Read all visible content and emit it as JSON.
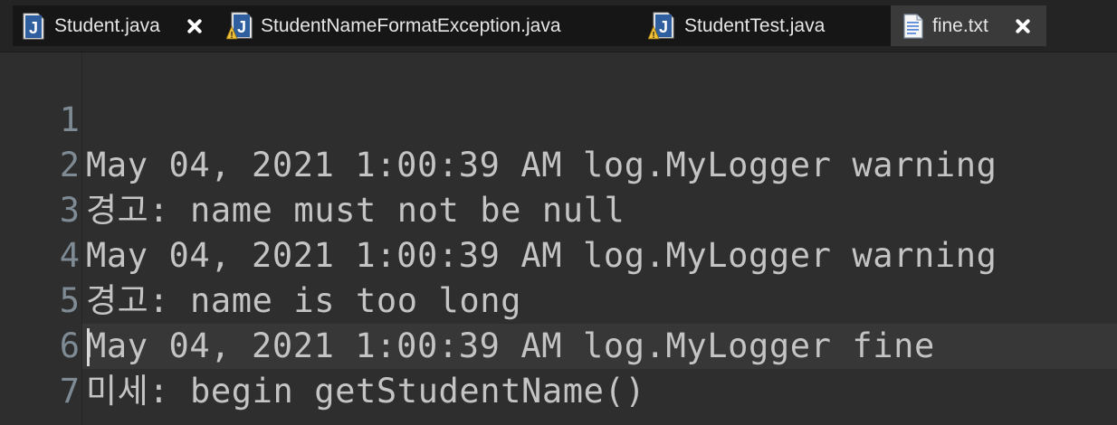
{
  "tabs": [
    {
      "label": "Student.java",
      "icon": "java-file-icon",
      "closable": true
    },
    {
      "label": "StudentNameFormatException.java",
      "icon": "java-file-warning-icon",
      "closable": false
    },
    {
      "label": "StudentTest.java",
      "icon": "java-file-warning-icon",
      "closable": false
    },
    {
      "label": "fine.txt",
      "icon": "text-file-icon",
      "closable": true
    }
  ],
  "editor": {
    "lines": [
      {
        "number": "1",
        "text": "May 04, 2021 1:00:39 AM log.MyLogger warning"
      },
      {
        "number": "2",
        "text": "경고: name must not be null"
      },
      {
        "number": "3",
        "text": "May 04, 2021 1:00:39 AM log.MyLogger warning"
      },
      {
        "number": "4",
        "text": "경고: name is too long"
      },
      {
        "number": "5",
        "text": "May 04, 2021 1:00:39 AM log.MyLogger fine"
      },
      {
        "number": "6",
        "text": "미세: begin getStudentName()"
      },
      {
        "number": "7",
        "text": ""
      }
    ]
  },
  "colors": {
    "java_icon": "#2f5f9e",
    "warning_icon": "#f2c037",
    "line_numbers": "#7e8b95",
    "text": "#c4c4c4"
  }
}
